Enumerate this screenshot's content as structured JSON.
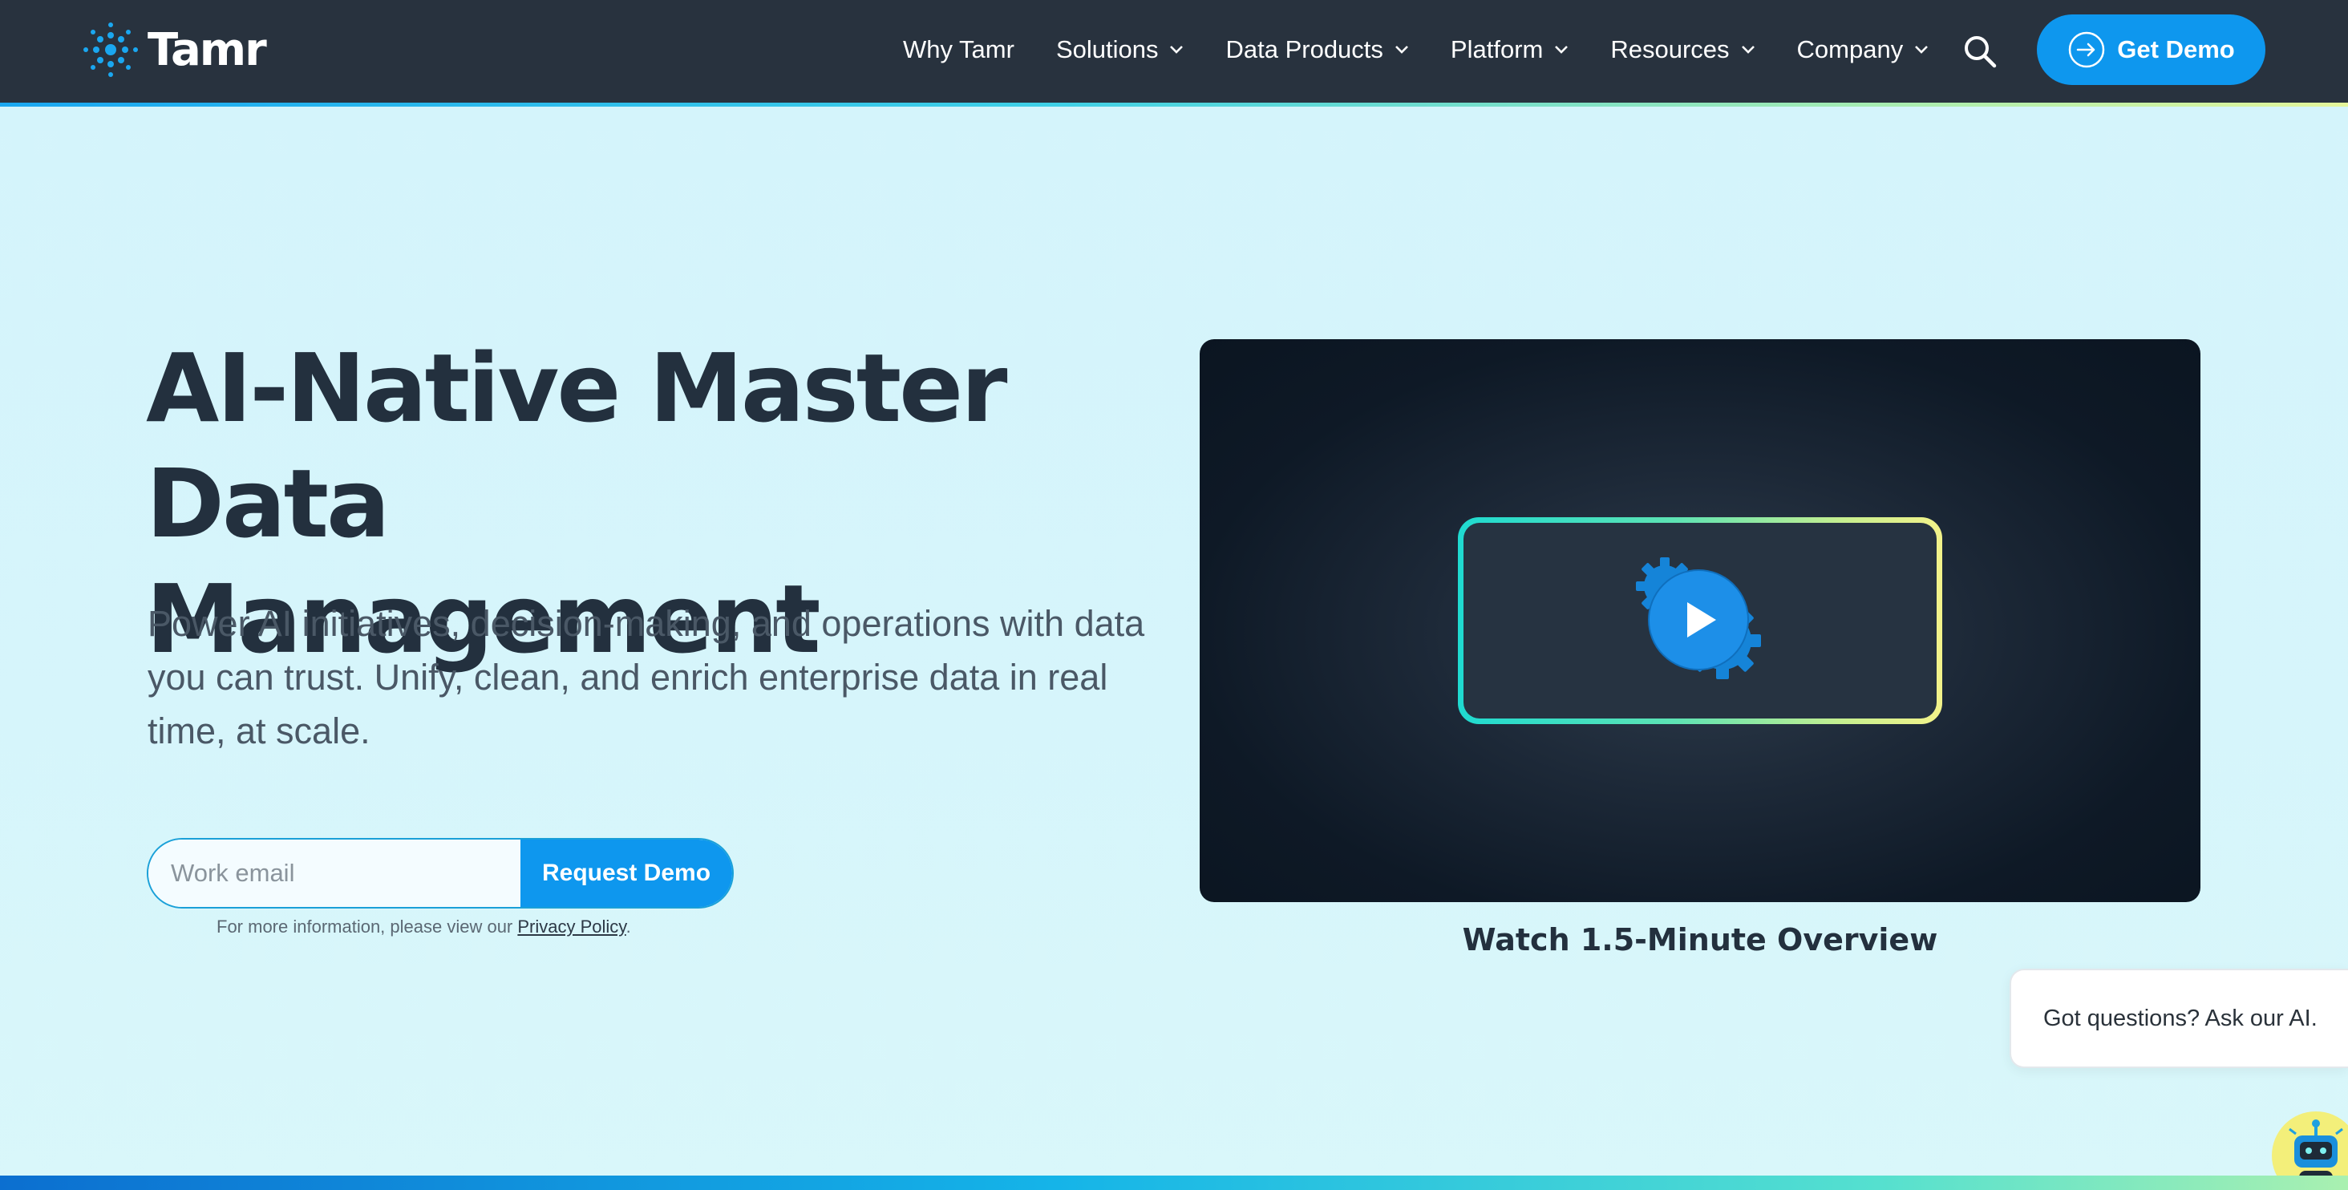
{
  "brand": {
    "name": "Tamr"
  },
  "nav": {
    "items": [
      {
        "label": "Why Tamr",
        "has_dropdown": false
      },
      {
        "label": "Solutions",
        "has_dropdown": true
      },
      {
        "label": "Data Products",
        "has_dropdown": true
      },
      {
        "label": "Platform",
        "has_dropdown": true
      },
      {
        "label": "Resources",
        "has_dropdown": true
      },
      {
        "label": "Company",
        "has_dropdown": true
      }
    ],
    "search_icon": "search-icon",
    "cta_label": "Get Demo"
  },
  "hero": {
    "title_line1": "AI-Native Master Data",
    "title_line2": "Management",
    "subtitle": "Power AI initiatives, decision-making, and operations with data you can trust. Unify, clean, and enrich enterprise data in real time, at scale.",
    "email_placeholder": "Work email",
    "submit_label": "Request Demo",
    "privacy_prefix": "For more information, please view our ",
    "privacy_link": "Privacy Policy",
    "privacy_suffix": "."
  },
  "video": {
    "caption": "Watch 1.5-Minute Overview",
    "icon": "play-gears-icon"
  },
  "chat": {
    "prompt": "Got questions? Ask our AI.",
    "avatar_icon": "robot-icon"
  },
  "colors": {
    "header_bg": "#28323e",
    "accent_blue": "#0e97ee",
    "hero_bg": "#d4f4fb",
    "title_text": "#23303e"
  }
}
